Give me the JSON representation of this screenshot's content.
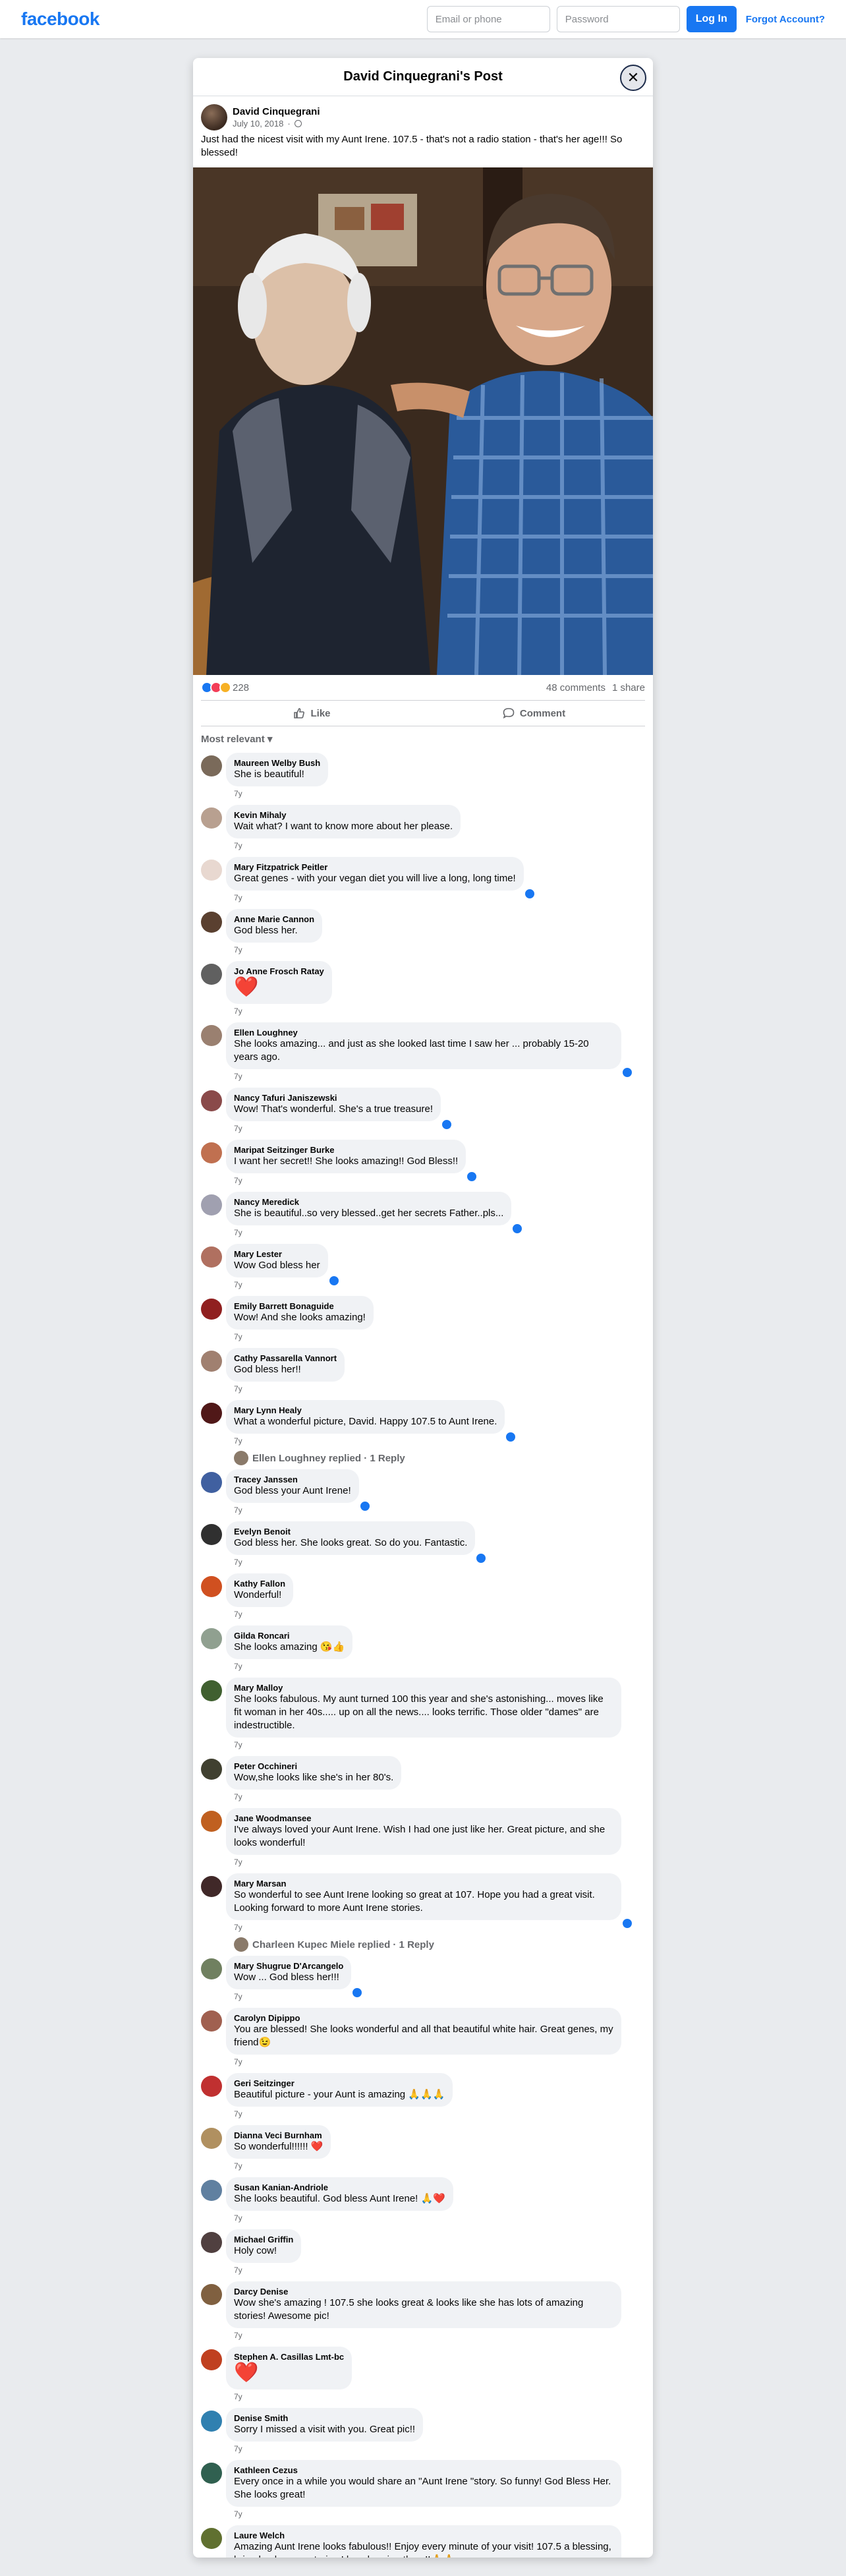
{
  "nav": {
    "logo": "facebook",
    "email_placeholder": "Email or phone",
    "password_placeholder": "Password",
    "login_label": "Log In",
    "forgot_label": "Forgot Account?"
  },
  "dialog": {
    "title": "David Cinquegrani's Post",
    "close_icon": "close-icon"
  },
  "post": {
    "author": "David Cinquegrani",
    "date": "July 10, 2018",
    "privacy_icon": "globe-icon",
    "text": "Just had the nicest visit with my Aunt Irene. 107.5 - that's not a radio station - that's her age!!! So blessed!",
    "reaction_count": "228",
    "comments_count": "48 comments",
    "shares_count": "1 share",
    "like_label": "Like",
    "comment_label": "Comment",
    "filter_label": "Most relevant"
  },
  "comments": [
    {
      "name": "Maureen Welby Bush",
      "text": "She is beautiful!",
      "time": "7y",
      "liked": false,
      "color": "#7a6a5a"
    },
    {
      "name": "Kevin Mihaly",
      "text": "Wait what? I want to know more about her please.",
      "time": "7y",
      "liked": false,
      "color": "#b8a090"
    },
    {
      "name": "Mary Fitzpatrick Peitler",
      "text": "Great genes - with your vegan diet you will live a long, long time!",
      "time": "7y",
      "liked": true,
      "color": "#e8d8d0"
    },
    {
      "name": "Anne Marie Cannon",
      "text": "God bless her.",
      "time": "7y",
      "liked": false,
      "color": "#5a4030"
    },
    {
      "name": "Jo Anne Frosch Ratay",
      "text": "❤️",
      "time": "7y",
      "liked": false,
      "heart": true,
      "color": "#606060"
    },
    {
      "name": "Ellen Loughney",
      "text": "She looks amazing... and just as she looked last time I saw her ... probably 15-20 years ago.",
      "time": "7y",
      "liked": true,
      "color": "#9a8070"
    },
    {
      "name": "Nancy Tafuri Janiszewski",
      "text": "Wow! That's wonderful. She's a true treasure!",
      "time": "7y",
      "liked": true,
      "color": "#8a4a4a"
    },
    {
      "name": "Maripat Seitzinger Burke",
      "text": "I want her secret!! She looks amazing!! God Bless!!",
      "time": "7y",
      "liked": true,
      "color": "#c07050"
    },
    {
      "name": "Nancy Meredick",
      "text": "She is beautiful..so very blessed..get her secrets Father..pls...",
      "time": "7y",
      "liked": true,
      "color": "#a0a0b0"
    },
    {
      "name": "Mary Lester",
      "text": "Wow God bless her",
      "time": "7y",
      "liked": true,
      "color": "#b07060"
    },
    {
      "name": "Emily Barrett Bonaguide",
      "text": "Wow! And she looks amazing!",
      "time": "7y",
      "liked": false,
      "color": "#902020"
    },
    {
      "name": "Cathy Passarella Vannort",
      "text": "God bless her!!",
      "time": "7y",
      "liked": false,
      "color": "#a08070"
    },
    {
      "name": "Mary Lynn Healy",
      "text": "What a wonderful picture, David. Happy 107.5 to Aunt Irene.",
      "time": "7y",
      "liked": true,
      "color": "#501818",
      "reply": "Ellen Loughney replied · 1 Reply"
    },
    {
      "name": "Tracey Janssen",
      "text": "God bless your Aunt Irene!",
      "time": "7y",
      "liked": true,
      "color": "#4060a0"
    },
    {
      "name": "Evelyn Benoit",
      "text": "God bless her. She looks great. So do you. Fantastic.",
      "time": "7y",
      "liked": true,
      "color": "#303030"
    },
    {
      "name": "Kathy Fallon",
      "text": "Wonderful!",
      "time": "7y",
      "liked": false,
      "color": "#d05020"
    },
    {
      "name": "Gilda Roncari",
      "text": "She looks amazing 😘👍",
      "time": "7y",
      "liked": false,
      "color": "#90a090"
    },
    {
      "name": "Mary Malloy",
      "text": "She looks fabulous. My aunt turned 100 this year and she's astonishing... moves like fit woman in her 40s..... up on all the news.... looks terrific. Those older \"dames\" are indestructible.",
      "time": "7y",
      "liked": false,
      "color": "#406030"
    },
    {
      "name": "Peter Occhineri",
      "text": "Wow,she looks like she's in her 80's.",
      "time": "7y",
      "liked": false,
      "color": "#404030"
    },
    {
      "name": "Jane Woodmansee",
      "text": "I've always loved your Aunt Irene. Wish I had one just like her. Great picture, and she looks wonderful!",
      "time": "7y",
      "liked": false,
      "color": "#c06020"
    },
    {
      "name": "Mary Marsan",
      "text": "So wonderful to see Aunt Irene looking so great at 107. Hope you had a great visit. Looking forward to more Aunt Irene stories.",
      "time": "7y",
      "liked": true,
      "color": "#402828",
      "reply": "Charleen Kupec Miele replied · 1 Reply"
    },
    {
      "name": "Mary Shugrue D'Arcangelo",
      "text": "Wow ... God bless her!!!",
      "time": "7y",
      "liked": true,
      "color": "#708060"
    },
    {
      "name": "Carolyn Dipippo",
      "text": "You are blessed! She looks wonderful and all that beautiful white hair. Great genes, my friend😉",
      "time": "7y",
      "liked": false,
      "color": "#a06050"
    },
    {
      "name": "Geri Seitzinger",
      "text": "Beautiful picture - your Aunt is amazing 🙏🙏🙏",
      "time": "7y",
      "liked": false,
      "color": "#c03030"
    },
    {
      "name": "Dianna Veci Burnham",
      "text": "So wonderful!!!!!! ❤️",
      "time": "7y",
      "liked": false,
      "color": "#b09060"
    },
    {
      "name": "Susan Kanian-Andriole",
      "text": "She looks beautiful. God bless Aunt Irene! 🙏❤️",
      "time": "7y",
      "liked": false,
      "color": "#6080a0"
    },
    {
      "name": "Michael Griffin",
      "text": "Holy cow!",
      "time": "7y",
      "liked": false,
      "color": "#504040"
    },
    {
      "name": "Darcy Denise",
      "text": "Wow she's amazing ! 107.5 she looks great & looks like she has lots of amazing stories! Awesome pic!",
      "time": "7y",
      "liked": false,
      "color": "#806040"
    },
    {
      "name": "Stephen A. Casillas Lmt-bc",
      "text": "❤️",
      "time": "7y",
      "liked": false,
      "heart": true,
      "color": "#c04020"
    },
    {
      "name": "Denise Smith",
      "text": "Sorry I missed a visit with you. Great pic!!",
      "time": "7y",
      "liked": false,
      "color": "#3080b0"
    },
    {
      "name": "Kathleen Cezus",
      "text": "Every once in a while you would share an \"Aunt Irene \"story. So funny! God Bless Her. She looks great!",
      "time": "7y",
      "liked": false,
      "color": "#306050"
    },
    {
      "name": "Laure Welch",
      "text": "Amazing Aunt Irene looks fabulous!! Enjoy every minute of your visit! 107.5 a blessing, bring back many stories I love hearing them!!🙏🙏",
      "time": "",
      "liked": false,
      "color": "#607030"
    }
  ]
}
